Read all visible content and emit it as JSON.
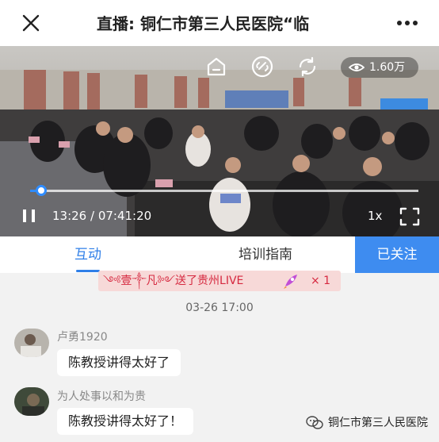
{
  "header": {
    "close_icon": "close-icon",
    "title": "直播: 铜仁市第三人民医院“临",
    "more_icon": "more-icon"
  },
  "video": {
    "controls_icons": [
      "home-icon",
      "link-icon",
      "refresh-icon"
    ],
    "view_count": "1.60万",
    "progress_fraction": 0.029,
    "time_label": "13:26 / 07:41:20",
    "speed_label": "1x",
    "progress_color": "#2f8cff"
  },
  "tabs": [
    {
      "label": "互动",
      "active": true
    },
    {
      "label": "培训指南",
      "active": false
    }
  ],
  "follow_label": "已关注",
  "gift": {
    "from": "༺壹༒凡༻送了贵州LIVE",
    "icon": "rocket-icon",
    "count": "× 1"
  },
  "timestamp": "03-26 17:00",
  "comments": [
    {
      "user": "卢勇1920",
      "text": "陈教授讲得太好了"
    },
    {
      "user": "为人处事以和为贵",
      "text": "陈教授讲得太好了！"
    }
  ],
  "watermark": {
    "icon": "wechat-icon",
    "text": "铜仁市第三人民医院"
  },
  "colors": {
    "accent": "#2f7fe8",
    "follow_bg": "#3e8cf0",
    "gift_bg": "#f7d9d8",
    "gift_text": "#d6283f"
  }
}
